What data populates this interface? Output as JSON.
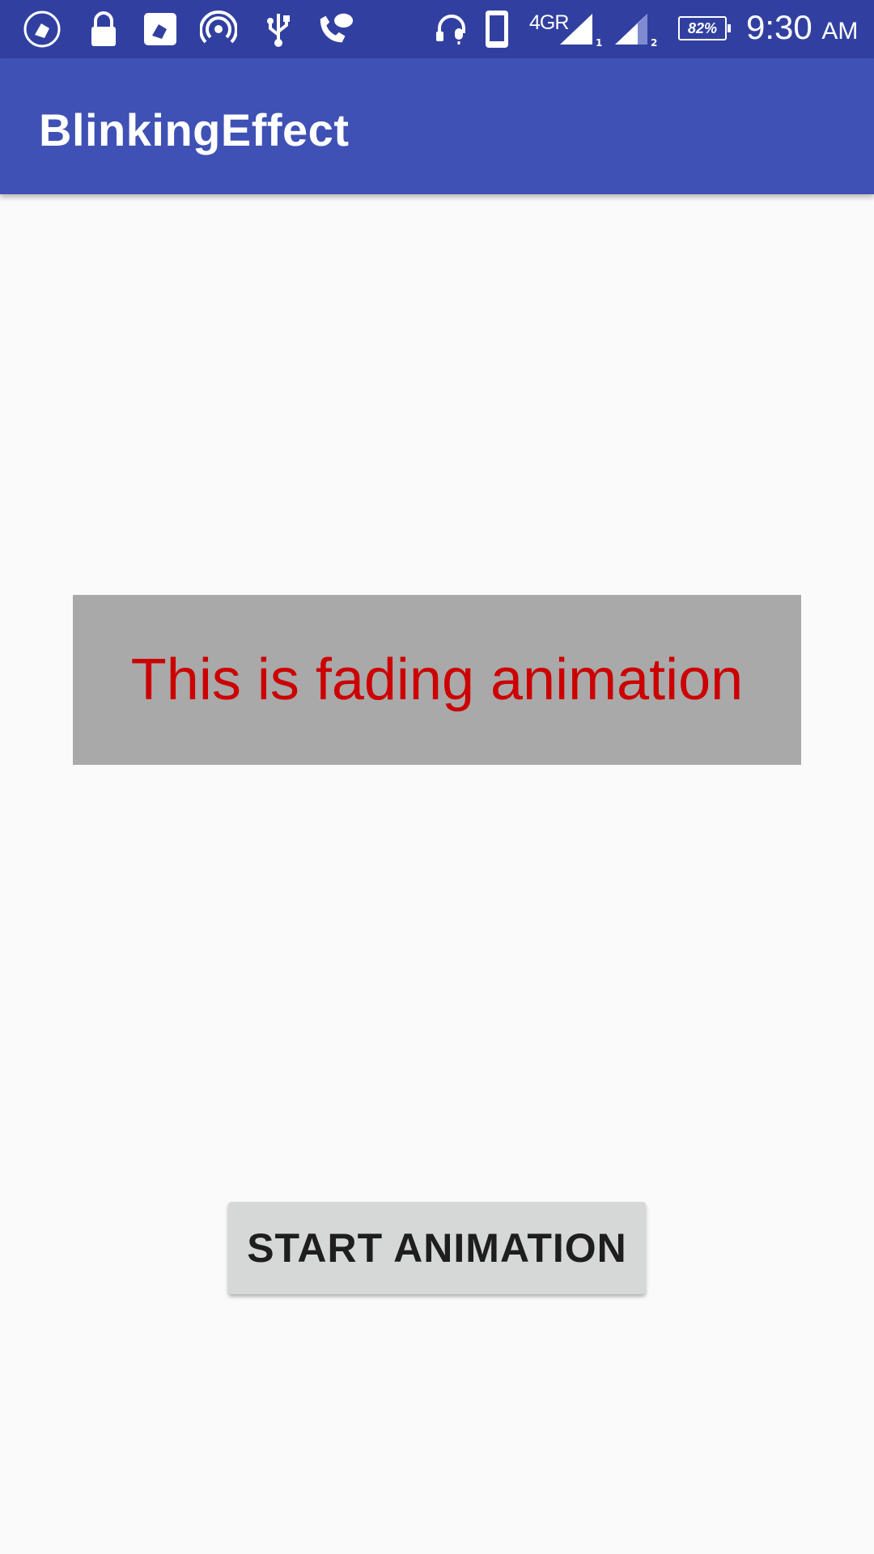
{
  "status_bar": {
    "icons": [
      "cleaner-icon",
      "lock-icon",
      "cleaner-app-icon",
      "hotspot-icon",
      "usb-icon",
      "wifi-calling-icon",
      "headset-icon",
      "phone-icon",
      "signal-sim1-icon",
      "signal-sim2-icon",
      "battery-icon"
    ],
    "network_label": "4GR",
    "battery_percent": "82%",
    "time": "9:30",
    "ampm": "AM",
    "background_color": "#3140a0"
  },
  "app_bar": {
    "title": "BlinkingEffect",
    "background_color": "#3f51b5"
  },
  "main": {
    "fade_text": "This is fading animation",
    "fade_text_color": "#cc0000",
    "fade_box_color": "#a9a9a9",
    "button_label": "START ANIMATION"
  }
}
